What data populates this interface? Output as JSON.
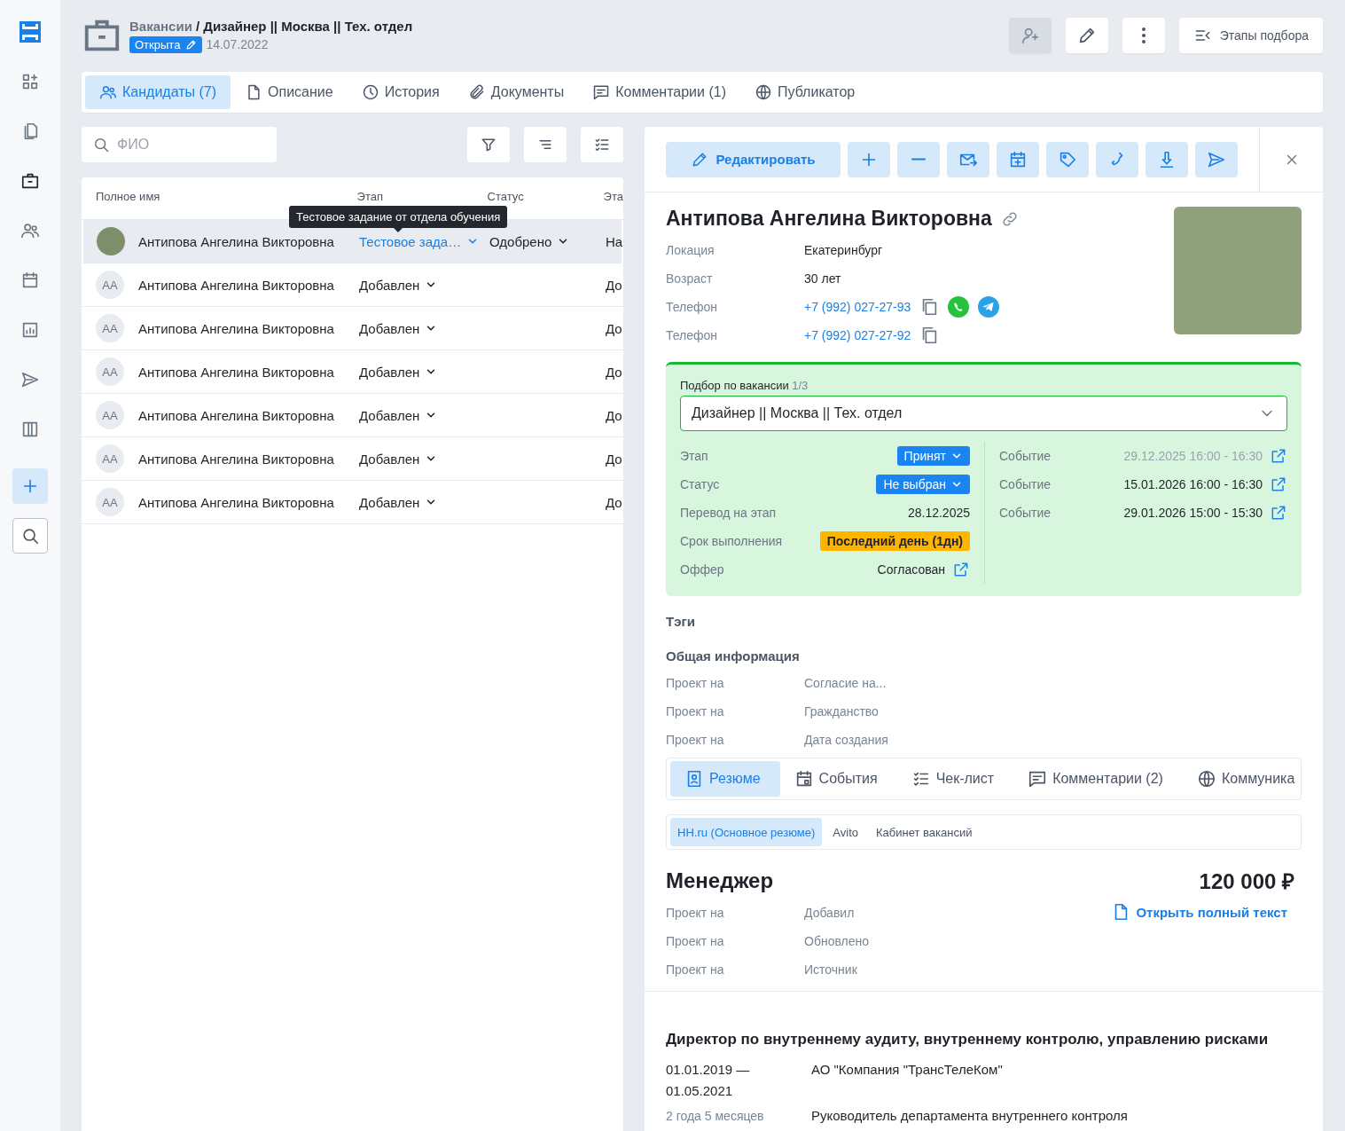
{
  "sidebar": {
    "items": [
      {
        "selected": false
      },
      {
        "selected": false
      },
      {
        "selected": true
      },
      {
        "selected": false
      },
      {
        "selected": false
      },
      {
        "selected": false
      },
      {
        "selected": false
      },
      {
        "selected": false
      }
    ]
  },
  "header": {
    "breadcrumb_parent": "Вакансии",
    "breadcrumb_current": "/ Дизайнер || Москва || Тех. отдел",
    "status": "Открыта",
    "date": "14.07.2022",
    "stages_button": "Этапы подбора"
  },
  "tabs": [
    {
      "label": "Кандидаты (7)",
      "selected": true
    },
    {
      "label": "Описание",
      "selected": false
    },
    {
      "label": "История",
      "selected": false
    },
    {
      "label": "Документы",
      "selected": false
    },
    {
      "label": "Комментарии (1)",
      "selected": false
    },
    {
      "label": "Публикатор",
      "selected": false
    }
  ],
  "candidates": {
    "search": {
      "placeholder": "ФИО"
    },
    "tooltip": "Тестовое задание от отдела обучения",
    "columns": [
      "Полное имя",
      "Этап",
      "Статус",
      "Эта"
    ],
    "rows": [
      {
        "name": "Антипова Ангелина Викторовна",
        "photo": true,
        "stage": "Тестовое зада…",
        "stage_link": true,
        "status": "Одобрено",
        "column_4": "На",
        "selected": true
      },
      {
        "name": "Антипова Ангелина Викторовна",
        "photo": false,
        "initials": "АА",
        "stage": "Добавлен",
        "stage_link": false,
        "column_4": "До",
        "selected": false
      },
      {
        "name": "Антипова Ангелина Викторовна",
        "photo": false,
        "initials": "АА",
        "stage": "Добавлен",
        "stage_link": false,
        "column_4": "До",
        "selected": false
      },
      {
        "name": "Антипова Ангелина Викторовна",
        "photo": false,
        "initials": "АА",
        "stage": "Добавлен",
        "stage_link": false,
        "column_4": "До",
        "selected": false
      },
      {
        "name": "Антипова Ангелина Викторовна",
        "photo": false,
        "initials": "АА",
        "stage": "Добавлен",
        "stage_link": false,
        "column_4": "До",
        "selected": false
      },
      {
        "name": "Антипова Ангелина Викторовна",
        "photo": false,
        "initials": "АА",
        "stage": "Добавлен",
        "stage_link": false,
        "column_4": "До",
        "selected": false
      },
      {
        "name": "Антипова Ангелина Викторовна",
        "photo": false,
        "initials": "АА",
        "stage": "Добавлен",
        "stage_link": false,
        "column_4": "До",
        "selected": false
      }
    ]
  },
  "candidate": {
    "edit_button": "Редактировать",
    "name": "Антипова Ангелина Викторовна",
    "fields": [
      {
        "label": "Локация",
        "value": "Екатеринбург",
        "kind": "text"
      },
      {
        "label": "Возраст",
        "value": "30 лет",
        "kind": "text"
      },
      {
        "label": "Телефон",
        "value": "+7 (992) 027-27-93",
        "kind": "phone",
        "messengers": true
      },
      {
        "label": "Телефон",
        "value": "+7 (992) 027-27-92",
        "kind": "phone",
        "messengers": false
      }
    ],
    "vacancy": {
      "label": "Подбор по вакансии",
      "counter": "1/3",
      "selected": "Дизайнер || Москва || Тех. отдел",
      "details": [
        {
          "label": "Этап",
          "value": "Принят",
          "kind": "dropdown"
        },
        {
          "label": "Статус",
          "value": "Не выбран",
          "kind": "dropdown"
        },
        {
          "label": "Перевод на этап",
          "value": "28.12.2025",
          "kind": "text"
        },
        {
          "label": "Срок выполнения",
          "value": "Последний день (1дн)",
          "kind": "warning"
        },
        {
          "label": "Оффер",
          "value": "Согласован",
          "kind": "link"
        }
      ],
      "events": [
        {
          "label": "Событие",
          "value": "29.12.2025 16:00 - 16:30",
          "past": true
        },
        {
          "label": "Событие",
          "value": "15.01.2026 16:00 - 16:30",
          "past": false
        },
        {
          "label": "Событие",
          "value": "29.01.2026 15:00 - 15:30",
          "past": false
        }
      ]
    },
    "tags_title": "Тэги",
    "info": {
      "title": "Общая информация",
      "rows": [
        {
          "label": "Проект на",
          "value": "Согласие на..."
        },
        {
          "label": "Проект на",
          "value": "Гражданство"
        },
        {
          "label": "Проект на",
          "value": "Дата создания"
        }
      ]
    },
    "resume_tabs": [
      {
        "label": "Резюме",
        "selected": true
      },
      {
        "label": "События",
        "selected": false
      },
      {
        "label": "Чек-лист",
        "selected": false
      },
      {
        "label": "Комментарии (2)",
        "selected": false
      },
      {
        "label": "Коммуника",
        "selected": false
      }
    ],
    "sources": [
      {
        "label": "HH.ru (Основное резюме)",
        "selected": true
      },
      {
        "label": "Avito",
        "selected": false
      },
      {
        "label": "Кабинет вакансий",
        "selected": false
      }
    ],
    "resume": {
      "title": "Менеджер",
      "salary": "120 000 ₽",
      "open_link": "Открыть полный текст",
      "rows": [
        {
          "label": "Проект на",
          "value": "Добавил"
        },
        {
          "label": "Проект на",
          "value": "Обновлено"
        },
        {
          "label": "Проект на",
          "value": "Источник"
        }
      ]
    },
    "experience": {
      "title": "Директор по внутреннему аудиту, внутреннему контролю, управлению рисками",
      "period": "01.01.2019 — 01.05.2021",
      "duration": "2 года 5 месяцев",
      "company": "АО \"Компания \"ТрансТелеКом\"",
      "position": "Руководитель департамента внутреннего контроля"
    }
  }
}
